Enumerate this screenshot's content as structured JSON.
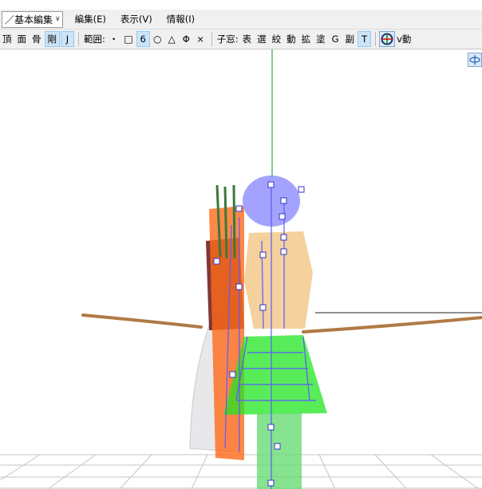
{
  "menubar": {
    "mode_select": "／基本編集",
    "items": [
      "編集(E)",
      "表示(V)",
      "情報(I)"
    ]
  },
  "toolbar": {
    "select_types": [
      "頂",
      "面",
      "骨",
      "剛",
      "J"
    ],
    "range_label": "範囲:",
    "range_buttons": [
      "・",
      "□",
      "6",
      "○",
      "△",
      "Φ",
      "×"
    ],
    "child_window_label": "子窓:",
    "child_buttons": [
      "表",
      "選",
      "絞",
      "動",
      "拡",
      "塗",
      "G",
      "副",
      "T"
    ],
    "tail_label": "v動"
  },
  "colors": {
    "toolbar_bg": "#f0f0f0",
    "toggle_on": "#cce4f7",
    "toggle_on_border": "#99c9ef",
    "y_axis": "#1a8f1a",
    "x_axis": "#222222",
    "bone_wire": "#5a5aff",
    "rigid_orange": "#ff6a1a",
    "rigid_green": "#22e622",
    "rigid_violet": "#8c8cff"
  },
  "icons": {
    "mode_dropdown": "chevron-down-icon",
    "axis_toggle": "axis-target-icon",
    "view_gizmo": "view-rotate-gizmo-icon"
  }
}
